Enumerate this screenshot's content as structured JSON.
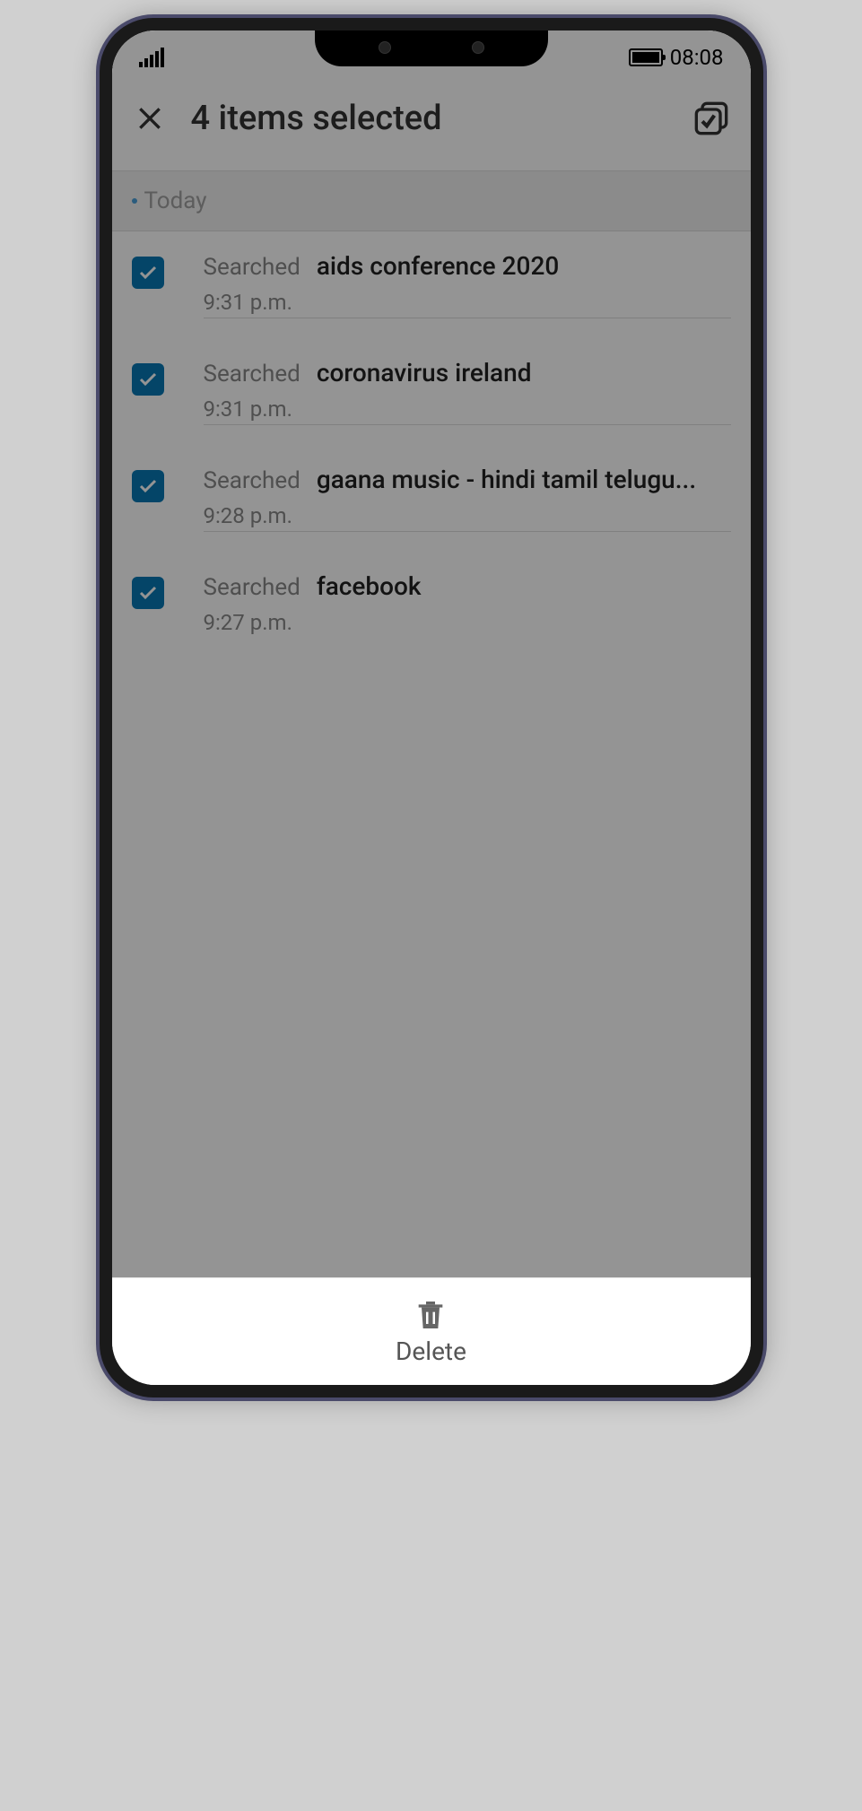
{
  "status_bar": {
    "time": "08:08"
  },
  "header": {
    "title": "4 items selected"
  },
  "section": {
    "label": "Today"
  },
  "history": [
    {
      "type": "Searched",
      "query": "aids conference 2020",
      "time": "9:31 p.m."
    },
    {
      "type": "Searched",
      "query": "coronavirus ireland",
      "time": "9:31 p.m."
    },
    {
      "type": "Searched",
      "query": "gaana music - hindi tamil telugu...",
      "time": "9:28 p.m."
    },
    {
      "type": "Searched",
      "query": "facebook",
      "time": "9:27 p.m."
    }
  ],
  "bottom_bar": {
    "delete_label": "Delete"
  }
}
